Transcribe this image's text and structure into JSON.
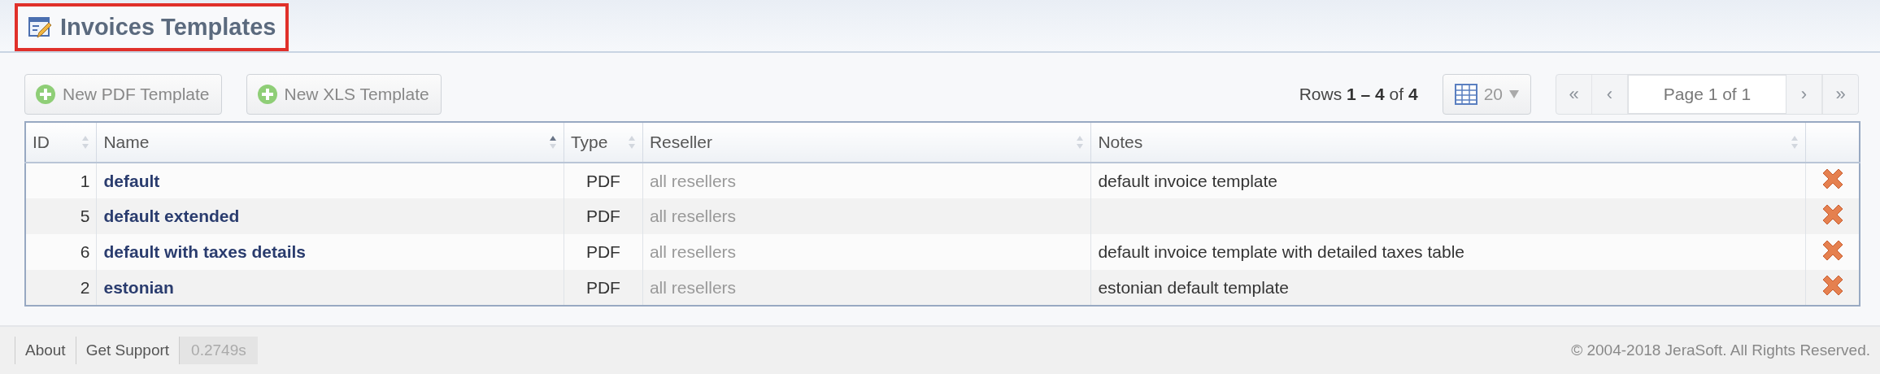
{
  "page": {
    "title": "Invoices Templates"
  },
  "toolbar": {
    "buttons": [
      {
        "label": "New PDF Template"
      },
      {
        "label": "New XLS Template"
      }
    ],
    "rows_info": "Rows **1 – 4** of **4**",
    "page_size": "20",
    "pager": {
      "first": "«",
      "prev": "‹",
      "page": "Page 1 of 1",
      "next": "›",
      "last": "»",
      "disabled": true
    }
  },
  "table": {
    "columns": [
      {
        "label": "ID",
        "sorted": false
      },
      {
        "label": "Name",
        "sorted": true
      },
      {
        "label": "Type",
        "sorted": false
      },
      {
        "label": "Reseller",
        "sorted": false
      },
      {
        "label": "Notes",
        "sorted": false
      }
    ],
    "rows": [
      {
        "id": "1",
        "name": "default",
        "type": "PDF",
        "reseller": "all resellers",
        "notes": "default invoice template"
      },
      {
        "id": "5",
        "name": "default extended",
        "type": "PDF",
        "reseller": "all resellers"
      },
      {
        "id": "6",
        "name": "default with taxes details",
        "type": "PDF",
        "reseller": "all resellers",
        "notes": "default invoice template with detailed taxes table"
      },
      {
        "id": "2",
        "name": "estonian",
        "type": "PDF",
        "reseller": "all resellers",
        "notes": "estonian default template"
      }
    ]
  },
  "footer": {
    "links": [
      "About",
      "Get Support"
    ],
    "timing": "0.2749s",
    "copyright": "© 2004-2018 JeraSoft. All Rights Reserved."
  }
}
